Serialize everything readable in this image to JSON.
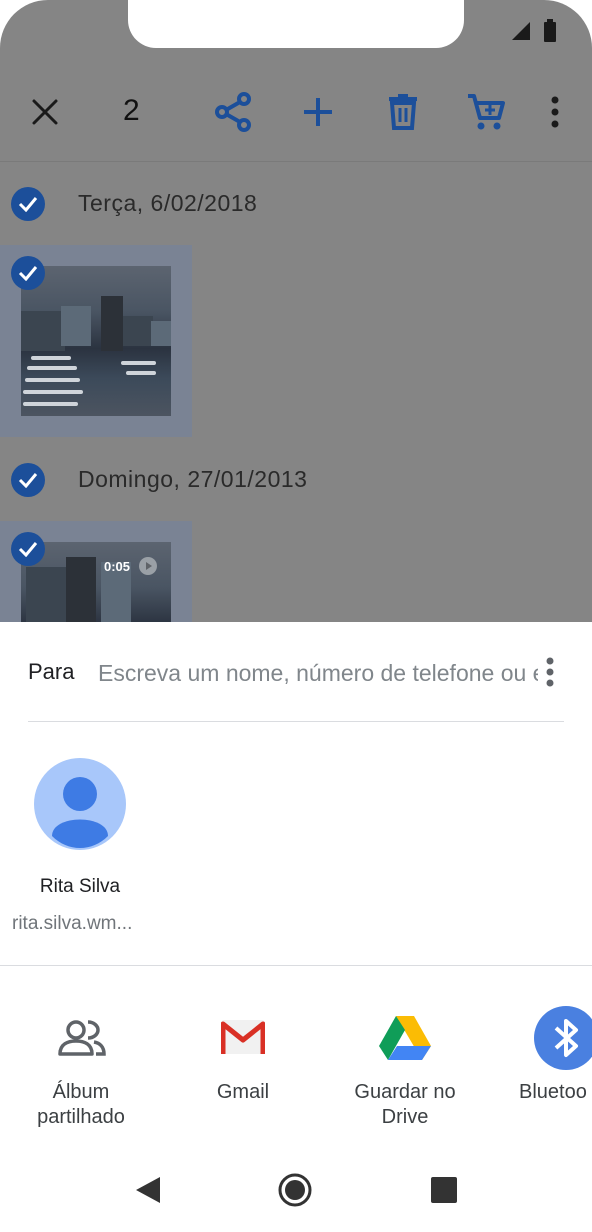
{
  "toolbar": {
    "selected_count": "2",
    "icons": [
      "close-icon",
      "share-icon",
      "add-icon",
      "trash-icon",
      "cart-icon",
      "more-vert-icon"
    ]
  },
  "gallery": {
    "groups": [
      {
        "date": "Terça, 6/02/2018"
      },
      {
        "date": "Domingo, 27/01/2013",
        "video_duration": "0:05"
      }
    ]
  },
  "share_sheet": {
    "to_label": "Para",
    "to_placeholder": "Escreva um nome, número de telefone ou e",
    "contact": {
      "name": "Rita Silva",
      "email": "rita.silva.wm..."
    },
    "apps": [
      {
        "label_line1": "Álbum",
        "label_line2": "partilhado",
        "icon": "people-icon"
      },
      {
        "label_line1": "Gmail",
        "label_line2": "",
        "icon": "gmail-icon"
      },
      {
        "label_line1": "Guardar no",
        "label_line2": "Drive",
        "icon": "drive-icon"
      },
      {
        "label_line1": "Bluetoo",
        "label_line2": "",
        "icon": "bluetooth-icon"
      }
    ]
  },
  "colors": {
    "accent_blue": "#1c4f9a",
    "dim_overlay": "#858585"
  }
}
